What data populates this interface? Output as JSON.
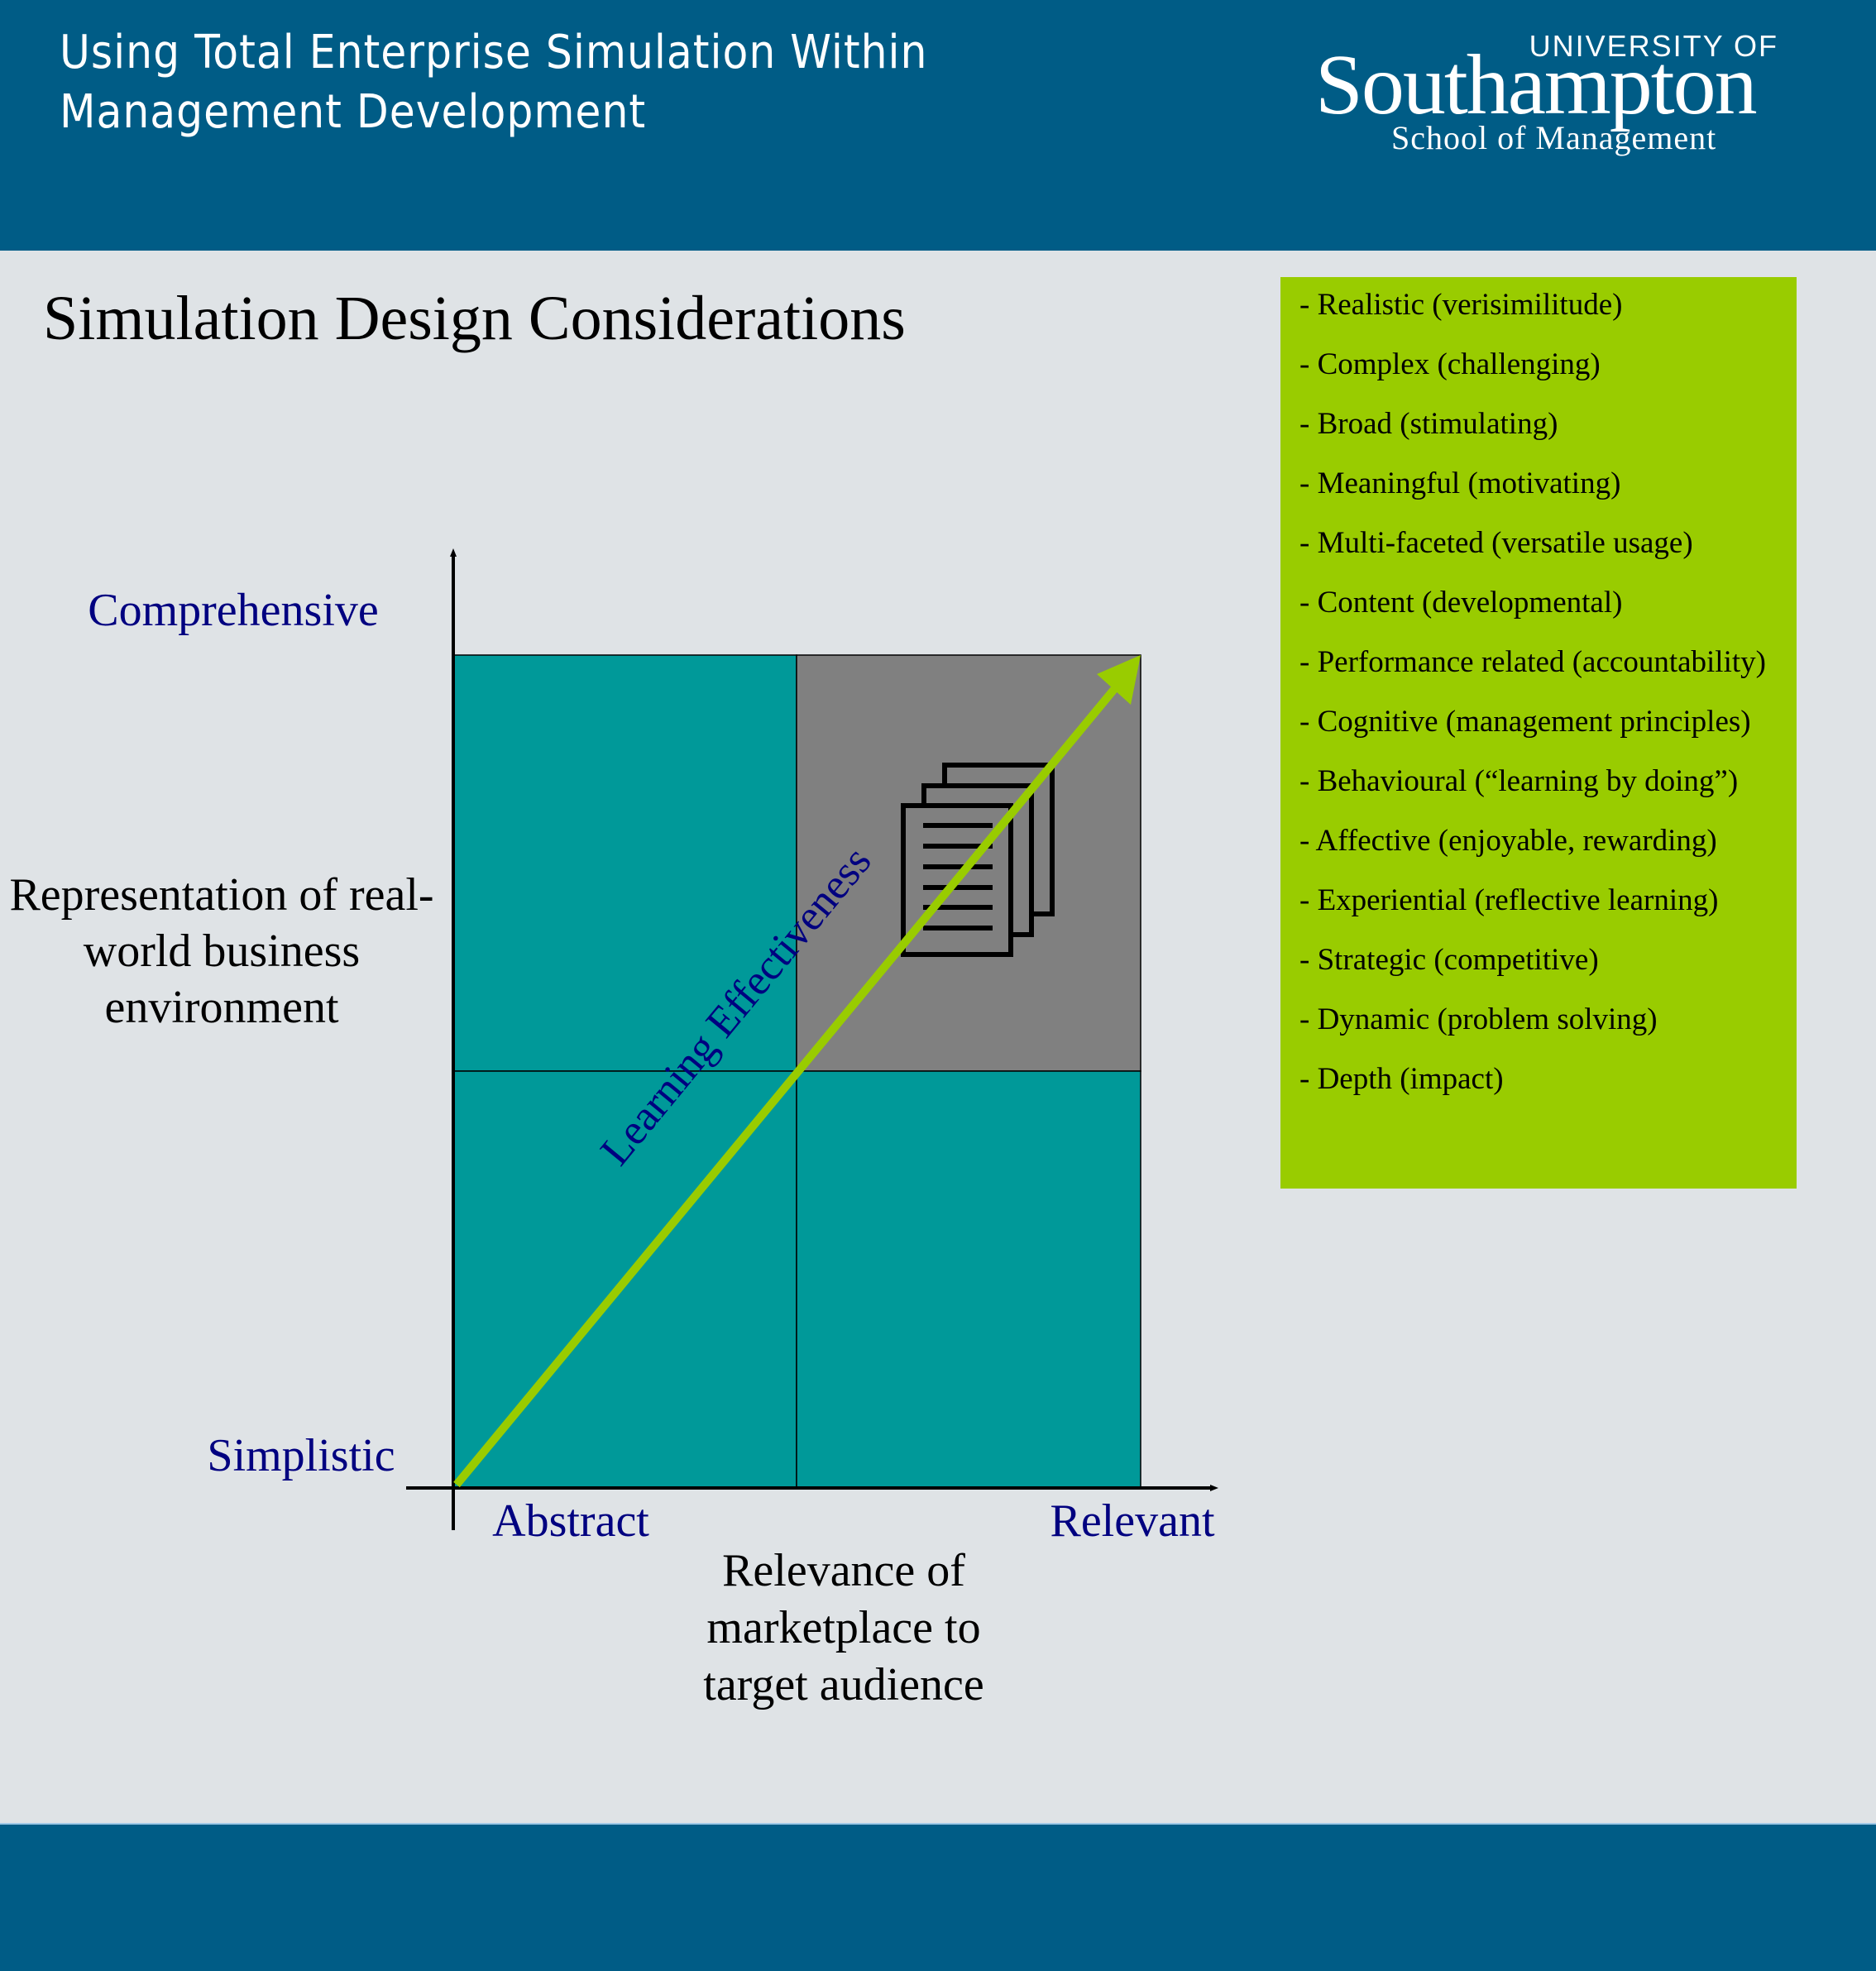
{
  "header": {
    "title_line1": "Using Total Enterprise Simulation Within",
    "title_line2": "Management Development",
    "logo": {
      "university_of": "UNIVERSITY OF",
      "name": "Southampton",
      "school": "School of Management"
    }
  },
  "page_title": "Simulation Design Considerations",
  "diagram": {
    "y_axis": {
      "title_lines": [
        "Representation of real-",
        "world business",
        "environment"
      ],
      "high_label": "Comprehensive",
      "low_label": "Simplistic"
    },
    "x_axis": {
      "title_lines": [
        "Relevance of",
        "marketplace to",
        "target audience"
      ],
      "low_label": "Abstract",
      "high_label": "Relevant"
    },
    "quadrants": [
      {
        "position": "top-left",
        "color": "#009999"
      },
      {
        "position": "top-right",
        "color": "#808080",
        "icon": "documents-icon"
      },
      {
        "position": "bottom-left",
        "color": "#009999"
      },
      {
        "position": "bottom-right",
        "color": "#009999"
      }
    ],
    "arrow": {
      "label": "Learning Effectiveness",
      "color": "#99cc00",
      "from": "bottom-left",
      "to": "top-right"
    }
  },
  "considerations": [
    "- Realistic (verisimilitude)",
    "- Complex (challenging)",
    "- Broad (stimulating)",
    "- Meaningful (motivating)",
    "- Multi-faceted (versatile usage)",
    "- Content (developmental)",
    "- Performance related (accountability)",
    "- Cognitive (management principles)",
    "- Behavioural (“learning by doing”)",
    "- Affective (enjoyable, rewarding)",
    "- Experiential (reflective learning)",
    "- Strategic (competitive)",
    "- Dynamic (problem solving)",
    "- Depth (impact)"
  ],
  "colors": {
    "brand_blue": "#005c86",
    "background": "#dfe3e6",
    "list_green": "#99cc00",
    "teal": "#009999",
    "grey": "#808080",
    "label_blue": "#000080"
  }
}
